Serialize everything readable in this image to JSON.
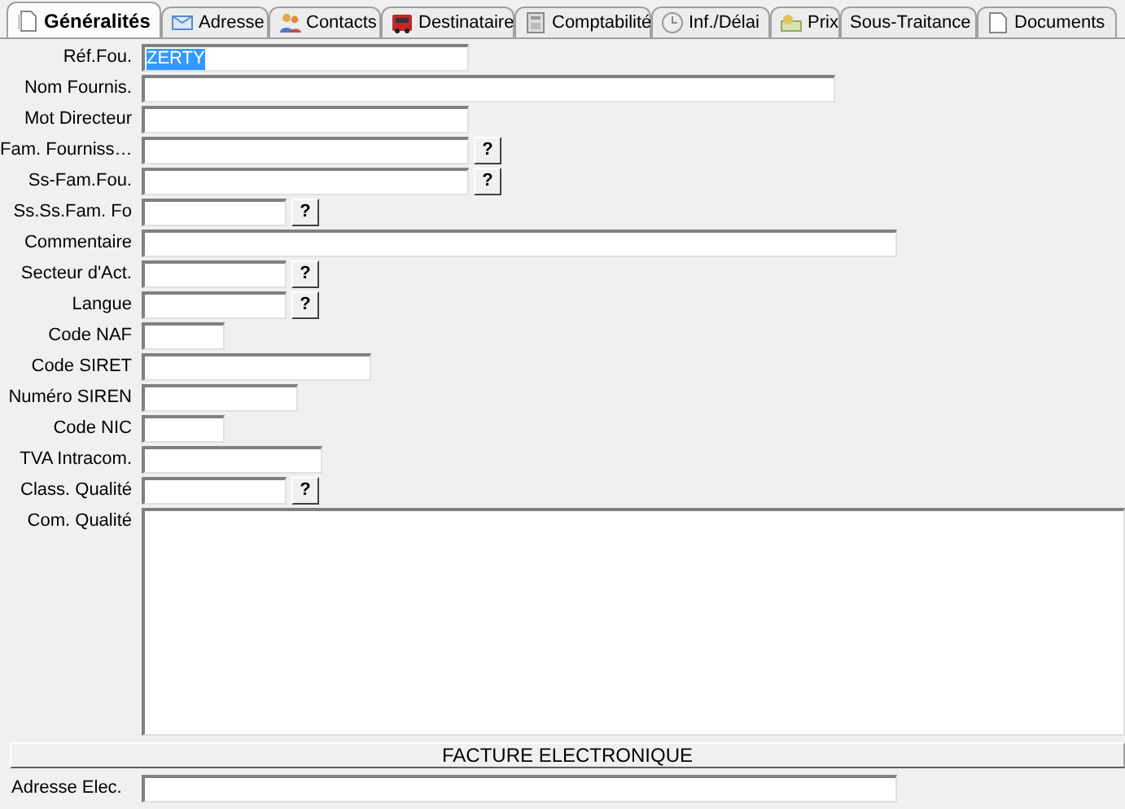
{
  "tabs": [
    {
      "label": "Généralités",
      "selected": true
    },
    {
      "label": "Adresse",
      "selected": false
    },
    {
      "label": "Contacts",
      "selected": false
    },
    {
      "label": "Destinataire",
      "selected": false
    },
    {
      "label": "Comptabilité",
      "selected": false
    },
    {
      "label": "Inf./Délai",
      "selected": false
    },
    {
      "label": "Prix",
      "selected": false
    },
    {
      "label": "Sous-Traitance",
      "selected": false
    },
    {
      "label": "Documents",
      "selected": false
    }
  ],
  "fields": [
    {
      "label": "Réf.Fou.",
      "value": "ZERTY",
      "value_selected": true
    },
    {
      "label": "Nom Fournis."
    },
    {
      "label": "Mot Directeur"
    },
    {
      "label": "Fam. Fourniss…",
      "help_button": "?"
    },
    {
      "label": "Ss-Fam.Fou.",
      "help_button": "?"
    },
    {
      "label": "Ss.Ss.Fam. Fo",
      "help_button": "?"
    },
    {
      "label": "Commentaire"
    },
    {
      "label": "Secteur d'Act.",
      "help_button": "?"
    },
    {
      "label": "Langue",
      "help_button": "?"
    },
    {
      "label": "Code NAF"
    },
    {
      "label": "Code SIRET"
    },
    {
      "label": "Numéro SIREN"
    },
    {
      "label": "Code NIC"
    },
    {
      "label": "TVA Intracom."
    },
    {
      "label": "Class. Qualité",
      "help_button": "?"
    },
    {
      "label": "Com. Qualité",
      "kind": "textarea"
    }
  ],
  "section": {
    "title": "FACTURE ELECTRONIQUE"
  },
  "electronic_address": {
    "label": "Adresse Elec."
  }
}
